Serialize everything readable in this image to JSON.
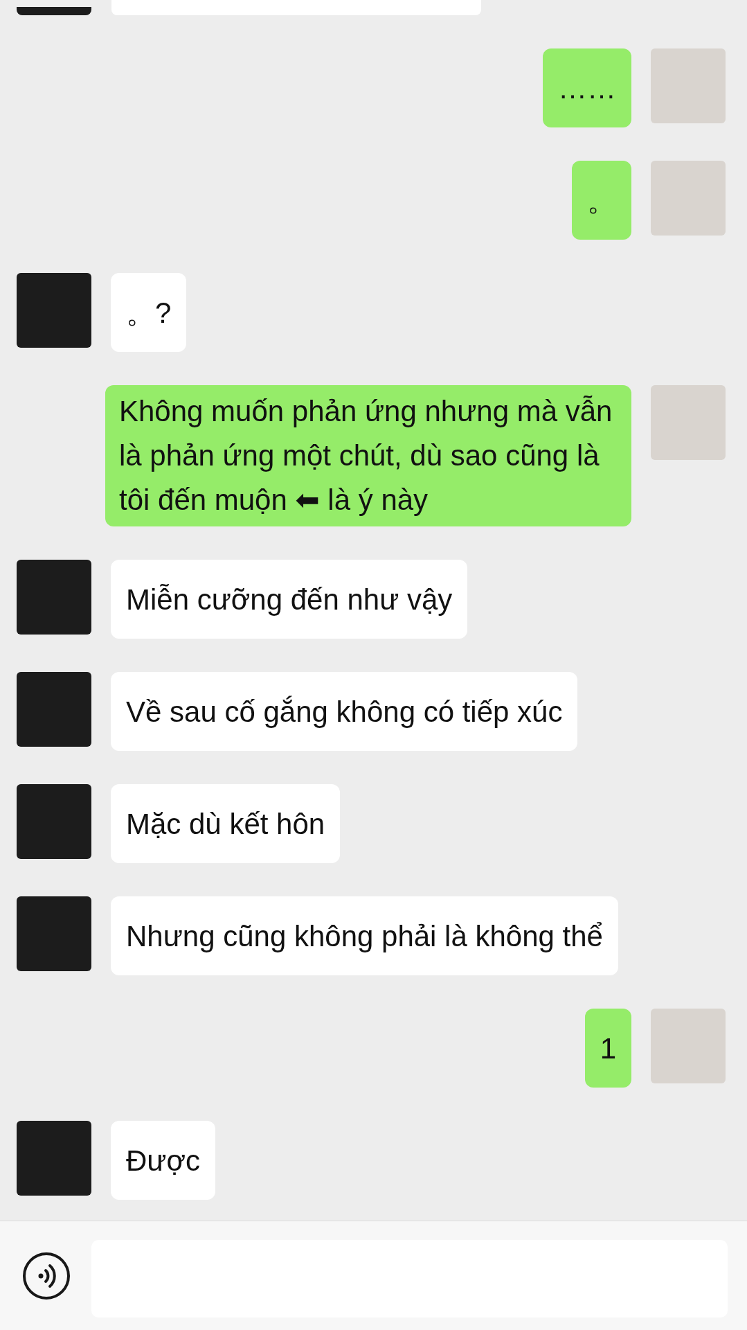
{
  "messages": [
    {
      "kind": "cropped",
      "outgoing": false
    },
    {
      "kind": "text",
      "outgoing": true,
      "text": "……"
    },
    {
      "kind": "text",
      "outgoing": true,
      "text": "。"
    },
    {
      "kind": "text",
      "outgoing": false,
      "text": "。?"
    },
    {
      "kind": "text",
      "outgoing": true,
      "text": "Không muốn phản ứng nhưng mà vẫn là phản ứng một chút, dù sao cũng là tôi đến muộn ⬅ là ý này"
    },
    {
      "kind": "text",
      "outgoing": false,
      "text": "Miễn cưỡng đến như vậy"
    },
    {
      "kind": "text",
      "outgoing": false,
      "text": "Về sau cố gắng không có tiếp xúc"
    },
    {
      "kind": "text",
      "outgoing": false,
      "text": "Mặc dù kết hôn"
    },
    {
      "kind": "text",
      "outgoing": false,
      "text": "Nhưng cũng không phải là không thể"
    },
    {
      "kind": "text",
      "outgoing": true,
      "text": "1"
    },
    {
      "kind": "text",
      "outgoing": false,
      "text": "Được"
    }
  ]
}
